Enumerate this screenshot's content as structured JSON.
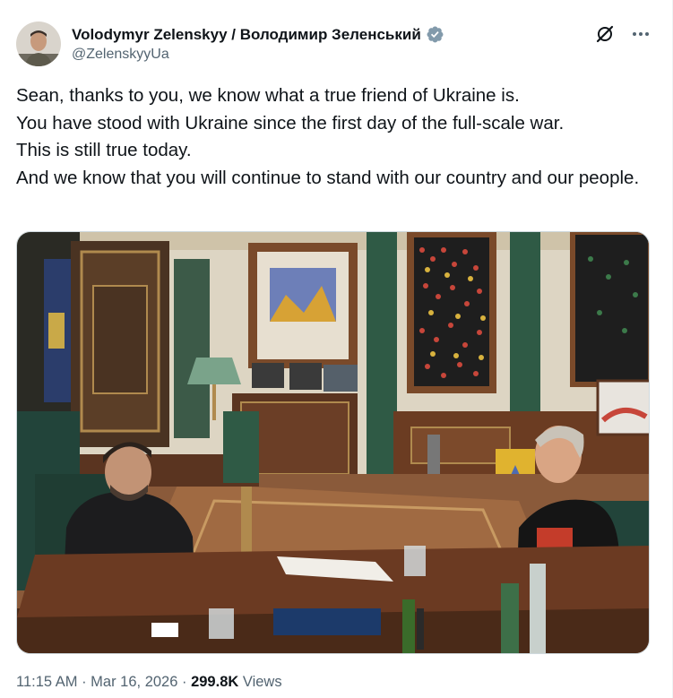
{
  "author": {
    "display_name": "Volodymyr Zelenskyy / Володимир Зеленський",
    "handle": "@ZelenskyyUa",
    "verified": true,
    "verified_color": "#829aab"
  },
  "header": {
    "grok_icon": "grok-icon",
    "more_icon": "more-icon"
  },
  "tweet": {
    "lines": [
      "Sean, thanks to you, we know what a true friend of Ukraine is.",
      "You have stood with Ukraine since the first day of the full-scale war.",
      "This is still true today.",
      "And we know that you will continue to stand with our country and our people."
    ]
  },
  "meta": {
    "time": "11:15 AM",
    "separator": " · ",
    "date": "Mar 16, 2026",
    "views_count": "299.8K",
    "views_label": " Views"
  },
  "colors": {
    "text": "#0f1419",
    "secondary": "#536471",
    "border": "#cfd9de"
  }
}
